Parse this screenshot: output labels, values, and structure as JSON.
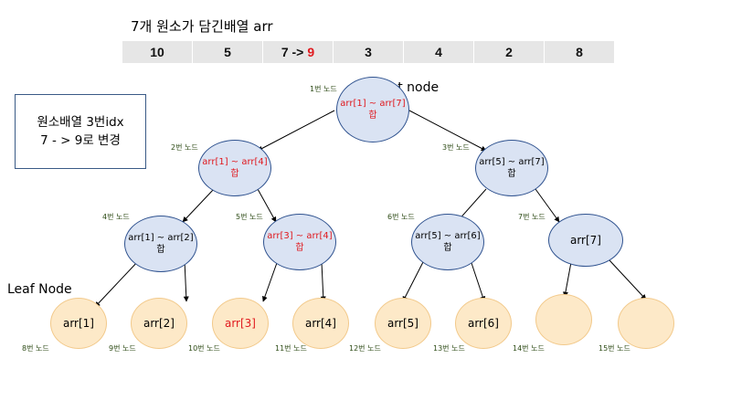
{
  "title": "7개 원소가 담긴배열 arr",
  "array_cells": [
    "10",
    "5",
    "7 ->",
    "3",
    "4",
    "2",
    "8"
  ],
  "array_new_value": "9",
  "info_box": {
    "line1": "원소배열 3번idx",
    "line2": "7 - > 9로 변경"
  },
  "labels": {
    "root": "Root node",
    "leaf": "Leaf Node"
  },
  "colors": {
    "highlight": "#e0191e",
    "internal_fill": "#dae3f3",
    "internal_border": "#2f528f",
    "leaf_fill": "#fde9c8",
    "leaf_border": "#f2c98a"
  },
  "nodes": {
    "n1": {
      "number": "1번 노드",
      "line1": "arr[1] ~ arr[7]",
      "line2": "합"
    },
    "n2": {
      "number": "2번 노드",
      "line1": "arr[1] ~ arr[4]",
      "line2": "합"
    },
    "n3": {
      "number": "3번 노드",
      "line1": "arr[5] ~ arr[7]",
      "line2": "합"
    },
    "n4": {
      "number": "4번 노드",
      "line1": "arr[1] ~ arr[2]",
      "line2": "합"
    },
    "n5": {
      "number": "5번 노드",
      "line1": "arr[3] ~ arr[4]",
      "line2": "합"
    },
    "n6": {
      "number": "6번 노드",
      "line1": "arr[5] ~ arr[6]",
      "line2": "합"
    },
    "n7": {
      "number": "7번 노드",
      "line1": "arr[7]"
    },
    "n8": {
      "number": "8번 노드",
      "line1": "arr[1]"
    },
    "n9": {
      "number": "9번 노드",
      "line1": "arr[2]"
    },
    "n10": {
      "number": "10번 노드",
      "line1": "arr[3]"
    },
    "n11": {
      "number": "11번 노드",
      "line1": "arr[4]"
    },
    "n12": {
      "number": "12번 노드",
      "line1": "arr[5]"
    },
    "n13": {
      "number": "13번 노드",
      "line1": "arr[6]"
    },
    "n14": {
      "number": "14번 노드"
    },
    "n15": {
      "number": "15번 노드"
    }
  }
}
